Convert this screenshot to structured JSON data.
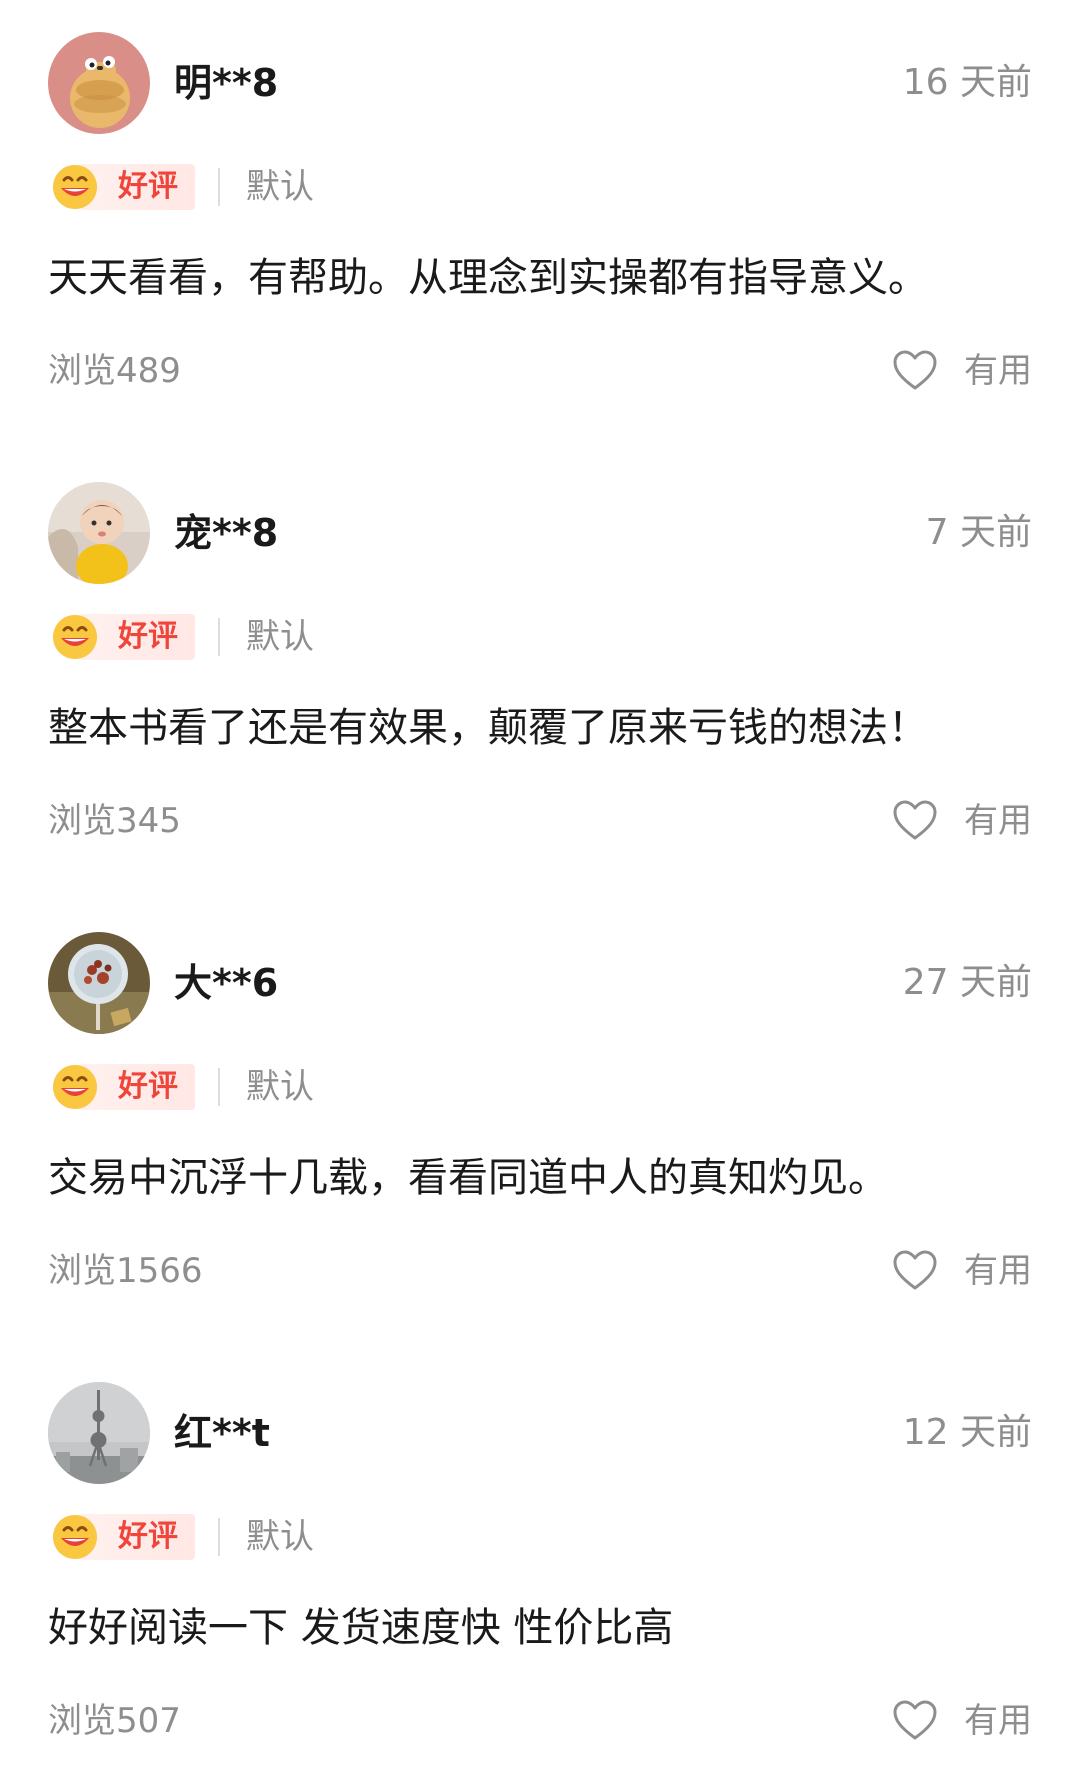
{
  "reviews": [
    {
      "username": "明**8",
      "time": "16 天前",
      "rating_label": "好评",
      "sort_tag": "默认",
      "text": "天天看看，有帮助。从理念到实操都有指导意义。",
      "views": "浏览489",
      "helpful_label": "有用",
      "avatar_icon": "cartoon-character-avatar"
    },
    {
      "username": "宠**8",
      "time": "7 天前",
      "rating_label": "好评",
      "sort_tag": "默认",
      "text": "整本书看了还是有效果，颠覆了原来亏钱的想法！",
      "views": "浏览345",
      "helpful_label": "有用",
      "avatar_icon": "baby-photo-avatar"
    },
    {
      "username": "大**6",
      "time": "27 天前",
      "rating_label": "好评",
      "sort_tag": "默认",
      "text": "交易中沉浮十几载，看看同道中人的真知灼见。",
      "views": "浏览1566",
      "helpful_label": "有用",
      "avatar_icon": "food-photo-avatar"
    },
    {
      "username": "红**t",
      "time": "12 天前",
      "rating_label": "好评",
      "sort_tag": "默认",
      "text": "好好阅读一下 发货速度快 性价比高",
      "views": "浏览507",
      "helpful_label": "有用",
      "avatar_icon": "city-tower-avatar"
    }
  ],
  "colors": {
    "rating_red": "#f0453b",
    "muted_gray": "#8e8e8e",
    "text_dark": "#1a1a1a"
  }
}
